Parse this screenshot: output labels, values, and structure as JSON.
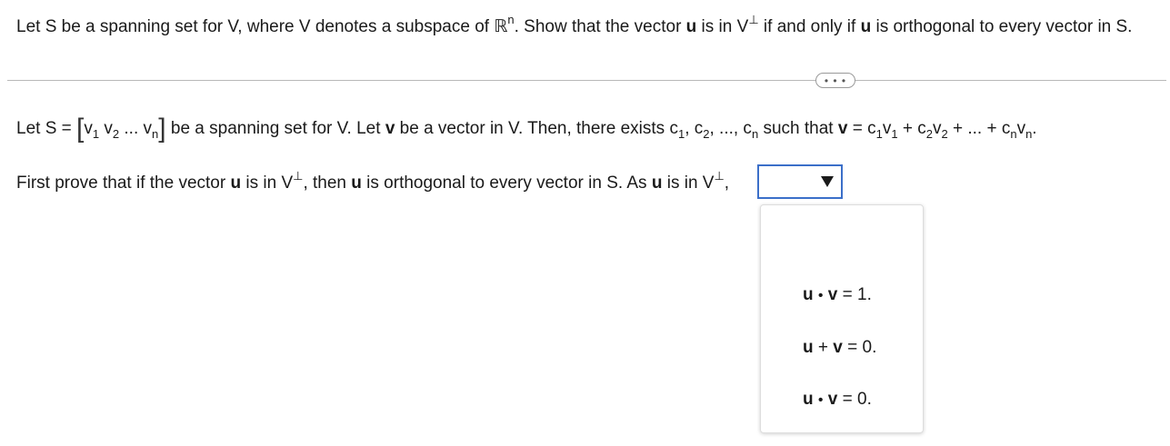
{
  "question": {
    "t1": "Let S be a spanning set for V, where V denotes a subspace of ",
    "R": "ℝ",
    "n": "n",
    "t2": ". Show that the vector ",
    "u": "u",
    "t3": " is in V",
    "perp": "⊥",
    "t4": " if and only if ",
    "t5": " is orthogonal to every vector in S."
  },
  "expand_button": {
    "label": "• • •"
  },
  "statement": {
    "t1": "Let S = ",
    "lbr": "[",
    "v": "v",
    "sub1": "1",
    "sub2": "2",
    "dots": "...",
    "subn": "n",
    "rbr": "]",
    "t2": " be a spanning set for V. Let ",
    "vb": "v",
    "t3": " be a vector in V. Then, there exists c",
    "comma": ",",
    "c2": " c",
    "t4": ", ..., c",
    "t5": " such that ",
    "eq": " = c",
    "plus1": " + c",
    "plus2": " + ... + c",
    "end": "."
  },
  "proof": {
    "t1": "First prove that if the vector ",
    "u": "u",
    "t2": " is in V",
    "perp": "⊥",
    "t3": ", then ",
    "t4": " is orthogonal to every vector in S. As ",
    "t5": " is in V",
    "t6": ","
  },
  "dropdown": {
    "selected": ""
  },
  "options": [
    {
      "u": "u",
      "op": "•",
      "v": "v",
      "rhs": " = 1."
    },
    {
      "u": "u",
      "op": "+",
      "v": "v",
      "rhs": " = 0."
    },
    {
      "u": "u",
      "op": "•",
      "v": "v",
      "rhs": " = 0."
    }
  ]
}
